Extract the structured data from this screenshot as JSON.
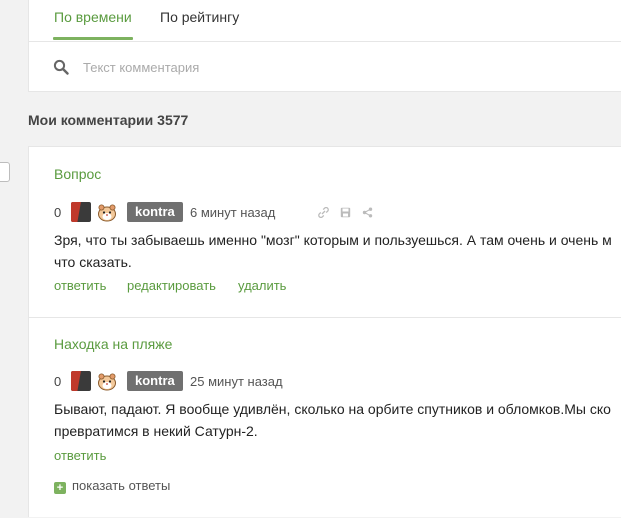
{
  "tabs": {
    "by_time": "По времени",
    "by_rating": "По рейтингу"
  },
  "search": {
    "placeholder": "Текст комментария"
  },
  "section": {
    "title": "Мои комментарии 3577"
  },
  "comments": [
    {
      "post_title": "Вопрос",
      "rating": "0",
      "author": "kontra",
      "time": "6 минут назад",
      "lines": [
        "Зря, что ты забываешь именно \"мозг\" которым и пользуешься. А там очень и очень м",
        "что сказать."
      ],
      "actions": {
        "reply": "ответить",
        "edit": "редактировать",
        "delete": "удалить"
      }
    },
    {
      "post_title": "Находка на пляже",
      "rating": "0",
      "author": "kontra",
      "time": "25 минут назад",
      "lines": [
        "Бывают, падают. Я вообще удивлён, сколько на орбите спутников и обломков.Мы ско",
        "превратимся в некий Сатурн-2."
      ],
      "actions": {
        "reply": "ответить",
        "show_replies": "показать ответы"
      }
    }
  ],
  "colors": {
    "accent": "#5a9b3f",
    "badge": "#707070"
  },
  "icons": [
    "search-icon",
    "link-icon",
    "save-icon",
    "share-icon",
    "hamster-icon",
    "plus-icon"
  ]
}
